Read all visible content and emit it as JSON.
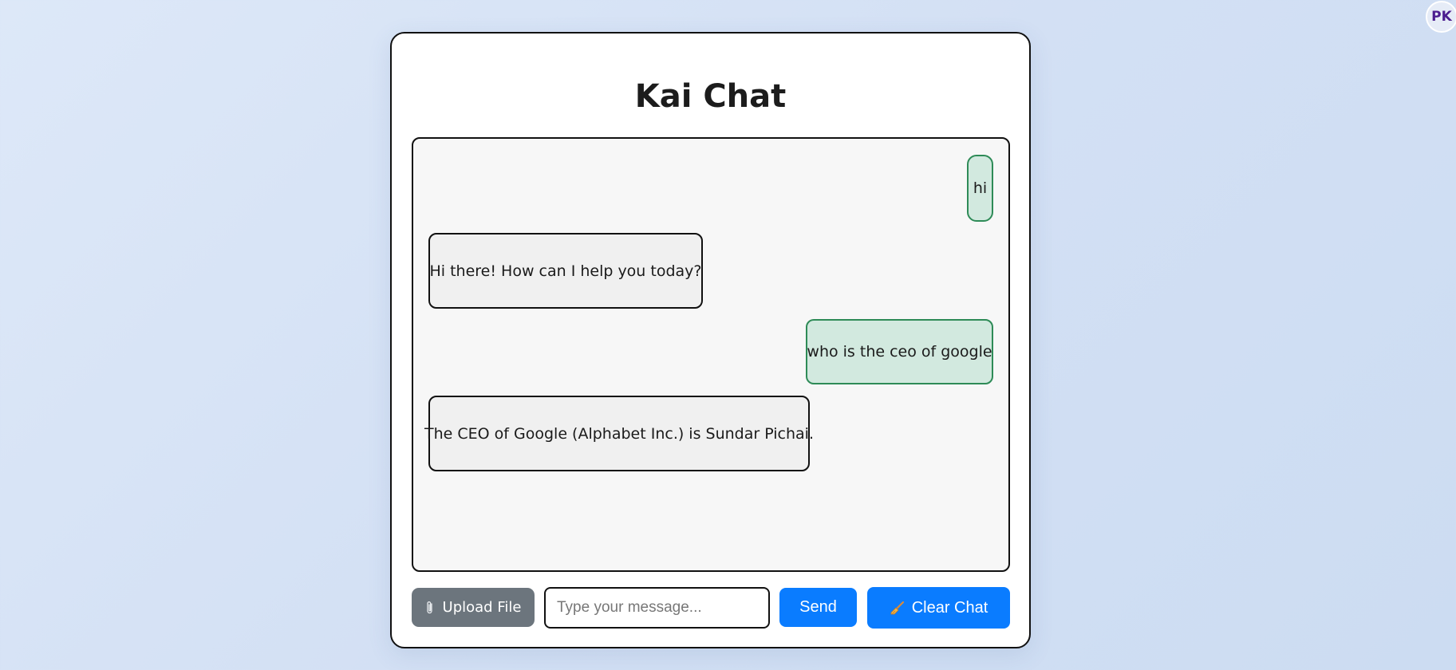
{
  "user": {
    "avatar_initials": "PK"
  },
  "header": {
    "title": "Kai Chat"
  },
  "chat": {
    "messages": [
      {
        "role": "user",
        "text": "hi"
      },
      {
        "role": "bot",
        "text": "Hi there! How can I help you today?"
      },
      {
        "role": "user",
        "text": "who is the ceo of google"
      },
      {
        "role": "bot",
        "text": "The CEO of Google (Alphabet Inc.) is Sundar Pichai."
      }
    ]
  },
  "controls": {
    "upload_label": "Upload File",
    "upload_icon": "paperclip-icon",
    "input_value": "",
    "input_placeholder": "Type your message...",
    "send_label": "Send",
    "clear_label": "Clear Chat",
    "clear_icon": "broom-icon"
  },
  "colors": {
    "primary": "#0a7cff",
    "secondary": "#6c757d",
    "user_bubble_bg": "#d2e9df",
    "user_bubble_border": "#2e8b57",
    "bot_bubble_bg": "#f0f0f0"
  }
}
